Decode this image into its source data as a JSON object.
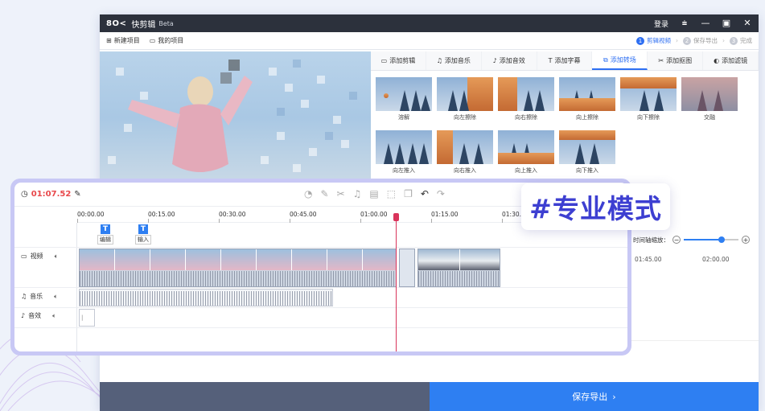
{
  "app": {
    "logo": "8O<",
    "name": "快剪辑",
    "beta": "Beta",
    "login": "登录"
  },
  "toolbar": {
    "new_project": "新建项目",
    "my_projects": "我的项目"
  },
  "steps": [
    {
      "num": "1",
      "label": "剪辑视频"
    },
    {
      "num": "2",
      "label": "保存导出"
    },
    {
      "num": "3",
      "label": "完成"
    }
  ],
  "tabs": [
    {
      "icon": "film-icon",
      "label": "添加剪辑"
    },
    {
      "icon": "music-note-icon",
      "label": "添加音乐"
    },
    {
      "icon": "sound-effect-icon",
      "label": "添加音效"
    },
    {
      "icon": "text-icon",
      "label": "添加字幕"
    },
    {
      "icon": "transition-icon",
      "label": "添加转场"
    },
    {
      "icon": "sticker-icon",
      "label": "添加抠图"
    },
    {
      "icon": "filter-icon",
      "label": "添加滤镜"
    }
  ],
  "transitions": [
    {
      "label": "溶解"
    },
    {
      "label": "向左擦除"
    },
    {
      "label": "向右擦除"
    },
    {
      "label": "向上擦除"
    },
    {
      "label": "向下擦除"
    },
    {
      "label": "交融"
    },
    {
      "label": "向左推入"
    },
    {
      "label": "向右推入"
    },
    {
      "label": "向上推入"
    },
    {
      "label": "向下推入"
    }
  ],
  "timeline": {
    "timecode": "01:07.52",
    "ruler": [
      "00:00.00",
      "00:15.00",
      "00:30.00",
      "00:45.00",
      "01:00.00",
      "01:15.00",
      "01:30.0"
    ],
    "tracks": {
      "video": "视频",
      "music": "音乐",
      "sfx": "音效"
    },
    "text_clips": [
      {
        "badge": "T",
        "label": "编辑"
      },
      {
        "badge": "T",
        "label": "输入"
      }
    ]
  },
  "zoom": {
    "label": "时间轴缩放：",
    "minus": "−",
    "plus": "+",
    "level": 0.67
  },
  "right_ruler": [
    "01:45.00",
    "02:00.00"
  ],
  "ghost_track_label": "音效",
  "export": {
    "label": "保存导出"
  },
  "pro_badge": "#专业模式",
  "colors": {
    "accent": "#2e7ff2",
    "timecode": "#e8474a",
    "badge_text": "#3d3fd1",
    "timeline_frame": "#c8c8f5"
  }
}
